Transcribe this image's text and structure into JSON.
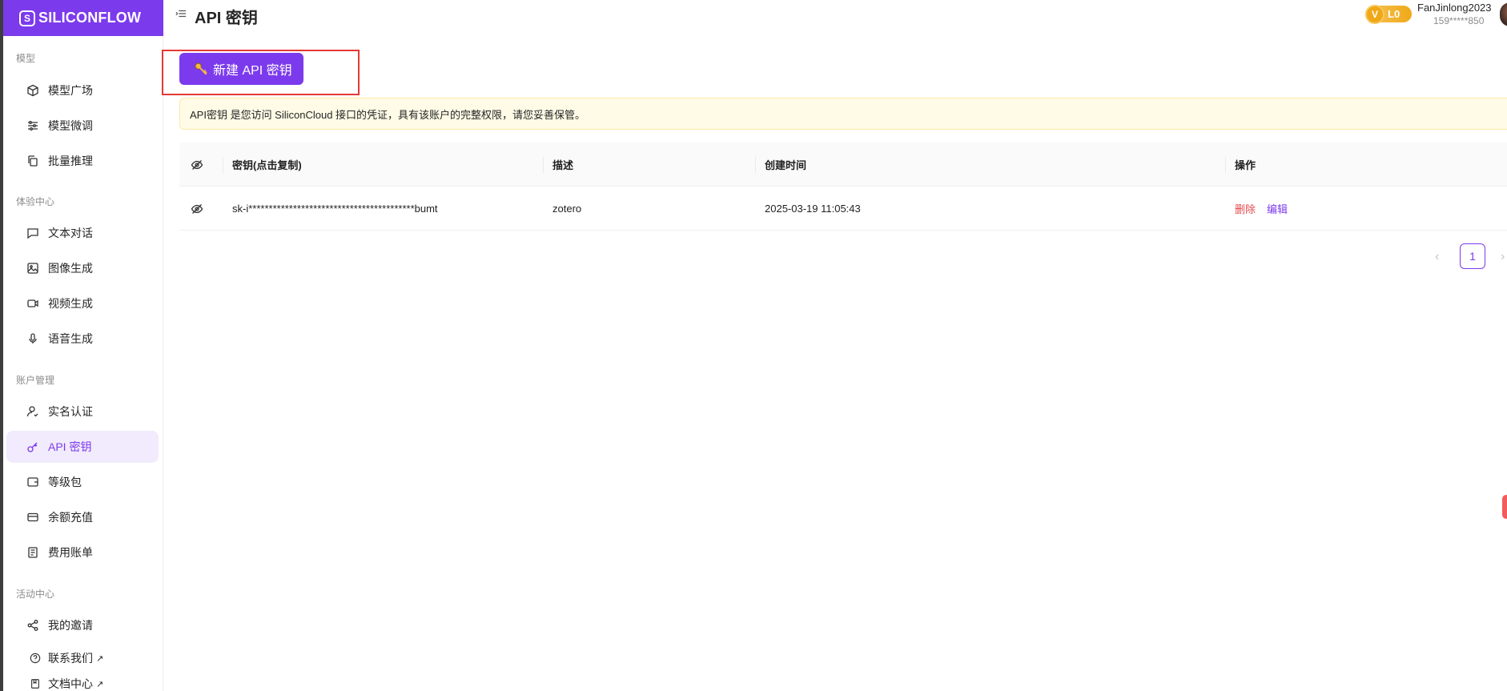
{
  "brand": {
    "logo_letter": "S",
    "name": "SILICONFLOW"
  },
  "sidebar": {
    "sections": [
      "模型",
      "体验中心",
      "账户管理",
      "活动中心"
    ],
    "items": [
      {
        "label": "模型广场",
        "icon": "cube-icon"
      },
      {
        "label": "模型微调",
        "icon": "sliders-icon"
      },
      {
        "label": "批量推理",
        "icon": "copy-icon"
      },
      {
        "label": "文本对话",
        "icon": "chat-icon"
      },
      {
        "label": "图像生成",
        "icon": "image-icon"
      },
      {
        "label": "视频生成",
        "icon": "video-icon"
      },
      {
        "label": "语音生成",
        "icon": "mic-icon"
      },
      {
        "label": "实名认证",
        "icon": "user-check-icon"
      },
      {
        "label": "API 密钥",
        "icon": "key-icon",
        "active": true
      },
      {
        "label": "等级包",
        "icon": "wallet-icon"
      },
      {
        "label": "余额充值",
        "icon": "card-icon"
      },
      {
        "label": "费用账单",
        "icon": "bill-icon"
      },
      {
        "label": "我的邀请",
        "icon": "share-icon"
      },
      {
        "label": "联系我们",
        "icon": "help-icon",
        "external": "↗"
      },
      {
        "label": "文档中心",
        "icon": "doc-icon",
        "external": "↗"
      }
    ]
  },
  "header": {
    "title": "API 密钥",
    "vip_badge": "V",
    "level": "L0",
    "username": "FanJinlong2023",
    "phone": "159*****850"
  },
  "main": {
    "new_key_button": "新建 API 密钥",
    "notice": "API密钥 是您访问 SiliconCloud 接口的凭证，具有该账户的完整权限，请您妥善保管。",
    "table": {
      "columns": [
        "密钥(点击复制)",
        "描述",
        "创建时间",
        "操作"
      ],
      "rows": [
        {
          "key": "sk-i*****************************************bumt",
          "description": "zotero",
          "created": "2025-03-19 11:05:43",
          "delete": "删除",
          "edit": "编辑"
        }
      ]
    },
    "pagination": {
      "prev": "‹",
      "current": "1",
      "next": "›"
    }
  },
  "colors": {
    "accent": "#7c3aed",
    "danger": "#e5484d",
    "notice_bg": "#fffbe6"
  }
}
